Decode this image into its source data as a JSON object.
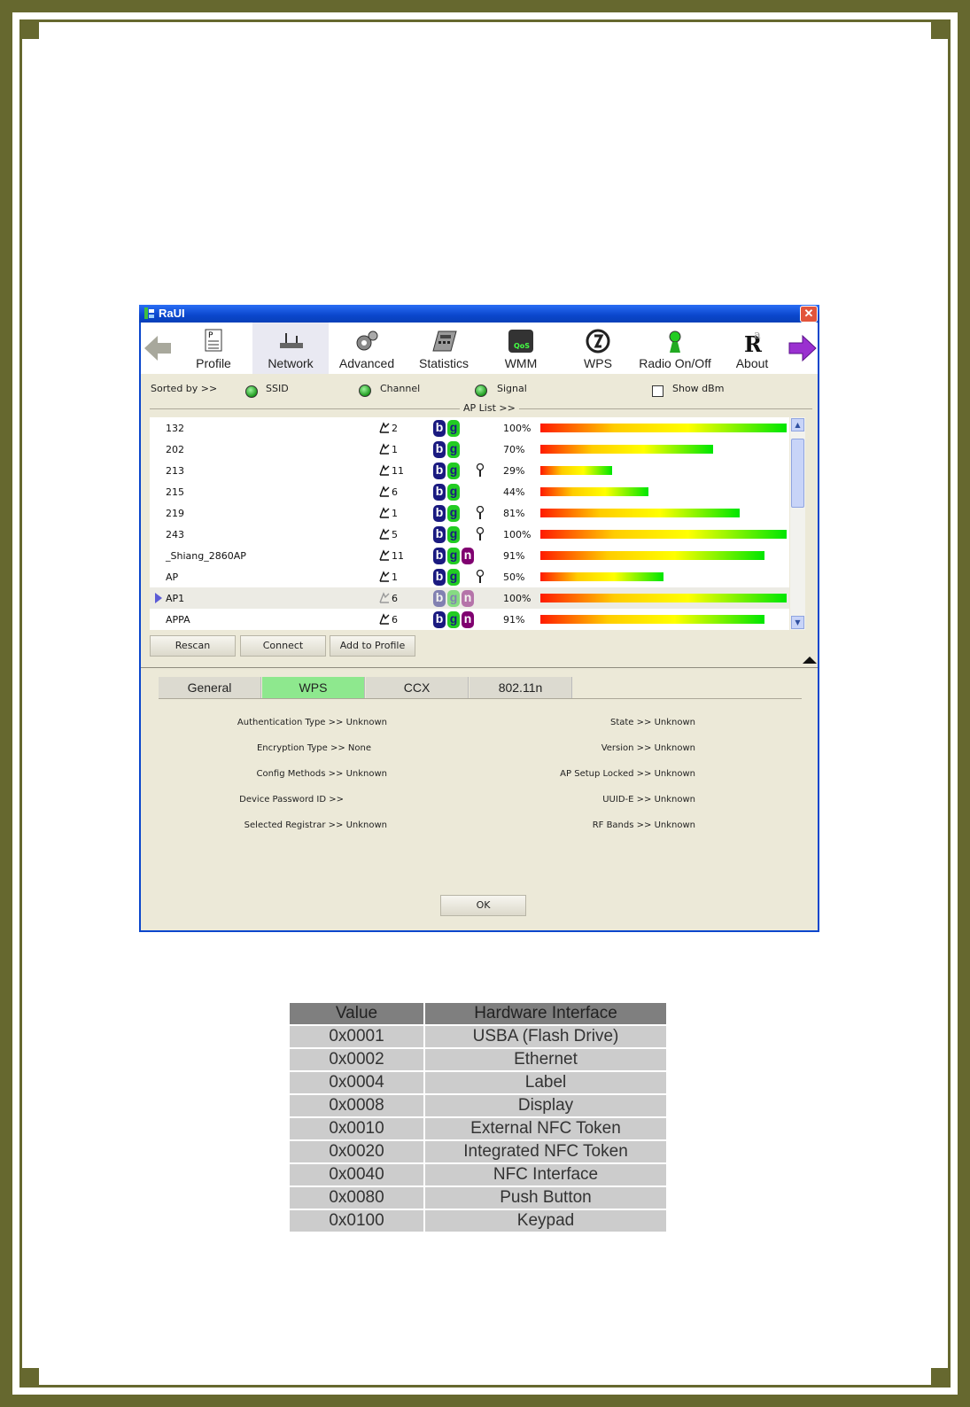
{
  "window": {
    "title": "RaUI",
    "close_glyph": "✕"
  },
  "toolbar": {
    "items": [
      {
        "label": "Profile",
        "icon": "profile-icon"
      },
      {
        "label": "Network",
        "icon": "network-icon",
        "active": true
      },
      {
        "label": "Advanced",
        "icon": "advanced-icon"
      },
      {
        "label": "Statistics",
        "icon": "statistics-icon"
      },
      {
        "label": "WMM",
        "icon": "wmm-qos-icon"
      },
      {
        "label": "WPS",
        "icon": "wps-icon"
      },
      {
        "label": "Radio On/Off",
        "icon": "radio-icon"
      },
      {
        "label": "About",
        "icon": "about-icon"
      }
    ]
  },
  "sort": {
    "label": "Sorted by >>",
    "ssid": "SSID",
    "channel": "Channel",
    "signal": "Signal",
    "show_dbm": "Show dBm"
  },
  "ap_list_label": "AP List >>",
  "ap_list": [
    {
      "ssid": "132",
      "channel": "2",
      "modes": [
        "b",
        "g"
      ],
      "secure": false,
      "signal": 100,
      "signal_text": "100%"
    },
    {
      "ssid": "202",
      "channel": "1",
      "modes": [
        "b",
        "g"
      ],
      "secure": false,
      "signal": 70,
      "signal_text": "70%"
    },
    {
      "ssid": "213",
      "channel": "11",
      "modes": [
        "b",
        "g"
      ],
      "secure": true,
      "signal": 29,
      "signal_text": "29%"
    },
    {
      "ssid": "215",
      "channel": "6",
      "modes": [
        "b",
        "g"
      ],
      "secure": false,
      "signal": 44,
      "signal_text": "44%"
    },
    {
      "ssid": "219",
      "channel": "1",
      "modes": [
        "b",
        "g"
      ],
      "secure": true,
      "signal": 81,
      "signal_text": "81%"
    },
    {
      "ssid": "243",
      "channel": "5",
      "modes": [
        "b",
        "g"
      ],
      "secure": true,
      "signal": 100,
      "signal_text": "100%"
    },
    {
      "ssid": "_Shiang_2860AP",
      "channel": "11",
      "modes": [
        "b",
        "g",
        "n"
      ],
      "secure": false,
      "signal": 91,
      "signal_text": "91%"
    },
    {
      "ssid": "AP",
      "channel": "1",
      "modes": [
        "b",
        "g"
      ],
      "secure": true,
      "signal": 50,
      "signal_text": "50%"
    },
    {
      "ssid": "AP1",
      "channel": "6",
      "modes": [
        "b",
        "g",
        "n"
      ],
      "secure": false,
      "signal": 100,
      "signal_text": "100%",
      "selected": true
    },
    {
      "ssid": "APPA",
      "channel": "6",
      "modes": [
        "b",
        "g",
        "n"
      ],
      "secure": false,
      "signal": 91,
      "signal_text": "91%"
    }
  ],
  "buttons": {
    "rescan": "Rescan",
    "connect": "Connect",
    "add_to_profile": "Add to Profile",
    "ok": "OK"
  },
  "tabs": [
    "General",
    "WPS",
    "CCX",
    "802.11n"
  ],
  "active_tab": "WPS",
  "details_left": [
    "Authentication Type >> Unknown",
    "Encryption Type >> None",
    "Config Methods >> Unknown",
    "Device Password ID >>",
    "Selected Registrar >> Unknown"
  ],
  "details_right": [
    "State >> Unknown",
    "Version >> Unknown",
    "AP Setup Locked >> Unknown",
    "UUID-E >> Unknown",
    "RF Bands >> Unknown"
  ],
  "hw_table": {
    "headers": [
      "Value",
      "Hardware Interface"
    ],
    "rows": [
      [
        "0x0001",
        "USBA (Flash Drive)"
      ],
      [
        "0x0002",
        "Ethernet"
      ],
      [
        "0x0004",
        "Label"
      ],
      [
        "0x0008",
        "Display"
      ],
      [
        "0x0010",
        "External NFC Token"
      ],
      [
        "0x0020",
        "Integrated NFC Token"
      ],
      [
        "0x0040",
        "NFC Interface"
      ],
      [
        "0x0080",
        "Push Button"
      ],
      [
        "0x0100",
        "Keypad"
      ]
    ]
  },
  "colors": {
    "frame": "#66682f",
    "title_bar": "#0a46cc",
    "active_tab": "#8ee88e"
  }
}
